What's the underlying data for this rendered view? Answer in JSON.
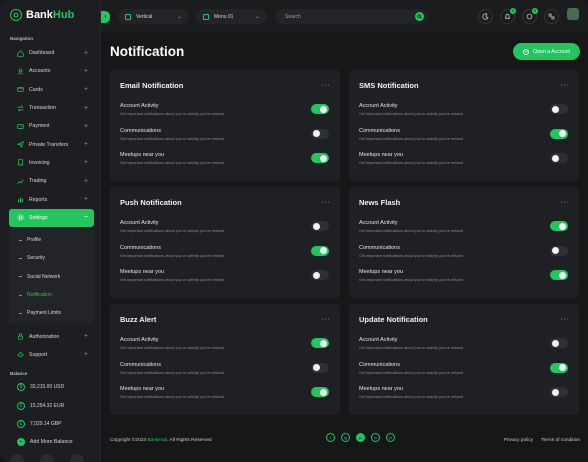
{
  "brand": {
    "name_a": "Bank",
    "name_b": "Hub"
  },
  "sidebar": {
    "navigation_title": "Navigation",
    "items": [
      {
        "label": "Dashboard"
      },
      {
        "label": "Accounts"
      },
      {
        "label": "Cards"
      },
      {
        "label": "Transaction"
      },
      {
        "label": "Payment"
      },
      {
        "label": "Private Transfers"
      },
      {
        "label": "Invoicing"
      },
      {
        "label": "Trading"
      },
      {
        "label": "Reports"
      },
      {
        "label": "Settings",
        "toggle": "−"
      }
    ],
    "settings_sub": [
      {
        "label": "Profile"
      },
      {
        "label": "Security"
      },
      {
        "label": "Social Network"
      },
      {
        "label": "Notification"
      },
      {
        "label": "Payment Limits"
      }
    ],
    "items_after": [
      {
        "label": "Authorization"
      },
      {
        "label": "Support"
      }
    ],
    "plus": "+",
    "balance_title": "Balance",
    "balances": [
      {
        "amount": "33,215.00 USD",
        "symbol": "$"
      },
      {
        "amount": "15,254.32 EUR",
        "symbol": "€"
      },
      {
        "amount": "7,029.14 GBP",
        "symbol": "£"
      }
    ],
    "add_balance": "Add More Balance"
  },
  "topbar": {
    "collapse_label": "‹",
    "layout_select": "Vertical",
    "menu_select": "Menu 01",
    "search_placeholder": "Search",
    "badges": {
      "notifications": "2",
      "messages": "3"
    }
  },
  "main": {
    "title": "Notification",
    "open_account_label": "Open a Account",
    "cards": [
      {
        "title": "Email Notification",
        "rows": [
          {
            "label": "Account Activity",
            "desc": "Get important notifications about you or activity you've missed",
            "on": true
          },
          {
            "label": "Communications",
            "desc": "Get important notifications about you or activity you've missed",
            "on": false
          },
          {
            "label": "Meetups near you",
            "desc": "Get important notifications about you or activity you've missed",
            "on": true
          }
        ]
      },
      {
        "title": "SMS Notification",
        "rows": [
          {
            "label": "Account Activity",
            "desc": "Get important notifications about you or activity you've missed",
            "on": false
          },
          {
            "label": "Communications",
            "desc": "Get important notifications about you or activity you've missed",
            "on": true
          },
          {
            "label": "Meetups near you",
            "desc": "Get important notifications about you or activity you've missed",
            "on": false
          }
        ]
      },
      {
        "title": "Push Notification",
        "rows": [
          {
            "label": "Account Activity",
            "desc": "Get important notifications about you or activity you've missed",
            "on": false
          },
          {
            "label": "Communications",
            "desc": "Get important notifications about you or activity you've missed",
            "on": true
          },
          {
            "label": "Meetups near you",
            "desc": "Get important notifications about you or activity you've missed",
            "on": false
          }
        ]
      },
      {
        "title": "News Flash",
        "rows": [
          {
            "label": "Account Activity",
            "desc": "Get important notifications about you or activity you've missed",
            "on": true
          },
          {
            "label": "Communications",
            "desc": "Get important notifications about you or activity you've missed",
            "on": false
          },
          {
            "label": "Meetups near you",
            "desc": "Get important notifications about you or activity you've missed",
            "on": true
          }
        ]
      },
      {
        "title": "Buzz Alert",
        "rows": [
          {
            "label": "Account Activity",
            "desc": "Get important notifications about you or activity you've missed",
            "on": true
          },
          {
            "label": "Communications",
            "desc": "Get important notifications about you or activity you've missed",
            "on": false
          },
          {
            "label": "Meetups near you",
            "desc": "Get important notifications about you or activity you've missed",
            "on": true
          }
        ]
      },
      {
        "title": "Update Notification",
        "rows": [
          {
            "label": "Account Activity",
            "desc": "Get important notifications about you or activity you've missed",
            "on": false
          },
          {
            "label": "Communications",
            "desc": "Get important notifications about you or activity you've missed",
            "on": true
          },
          {
            "label": "Meetups near you",
            "desc": "Get important notifications about you or activity you've missed",
            "on": false
          }
        ]
      }
    ],
    "more_label": "···"
  },
  "footer": {
    "copyright": "Copyright ©2023",
    "brand": "BankHub",
    "rights": ". All Rights Reserved",
    "socials": [
      "f",
      "ig",
      "p",
      "in",
      "yt"
    ],
    "privacy": "Privacy policy",
    "terms": "Terms of condition"
  },
  "colors": {
    "accent": "#22c55e",
    "bg": "#161719",
    "card": "#1f2023",
    "sidebar": "#1d1e21"
  }
}
